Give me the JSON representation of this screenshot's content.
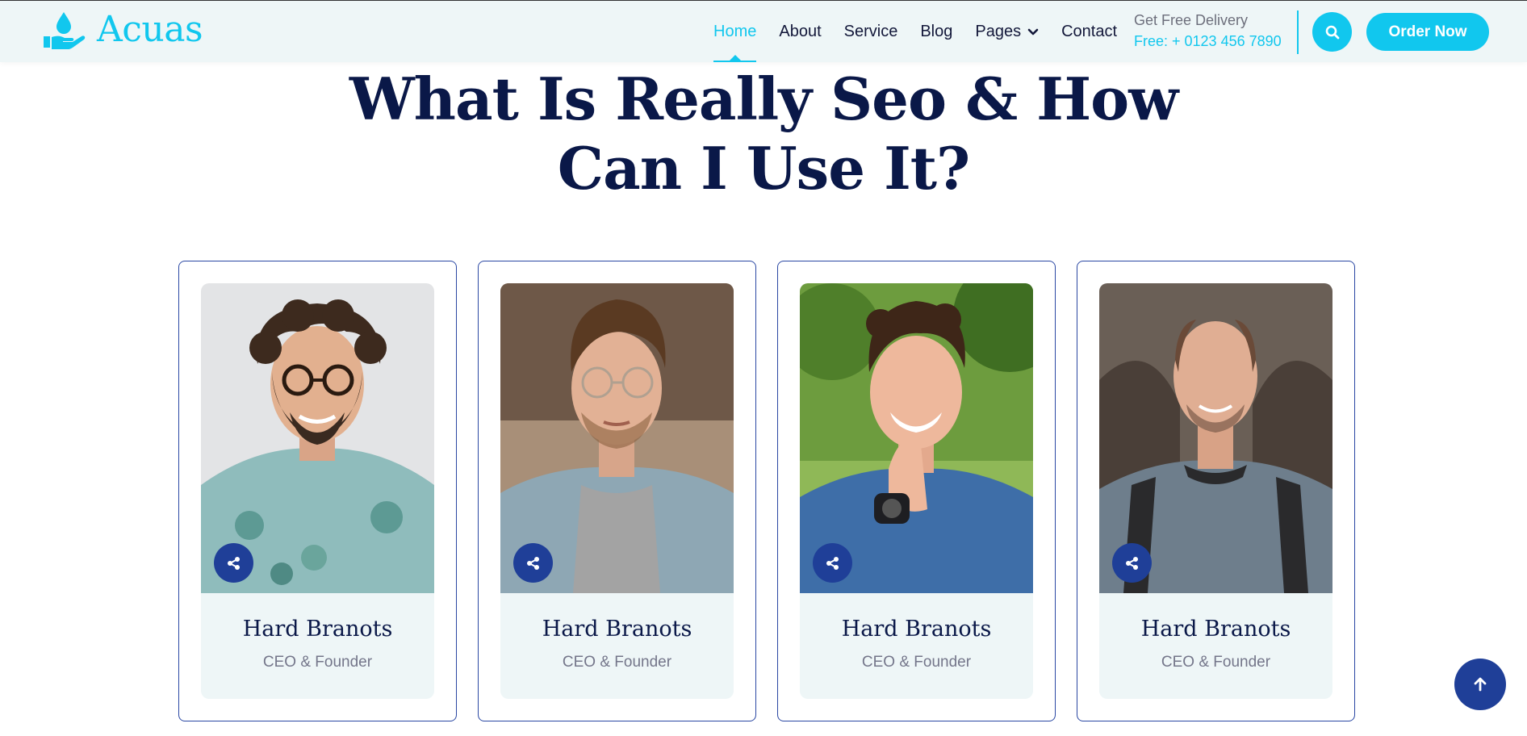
{
  "brand": {
    "name": "Acuas",
    "accent_color": "#11c7ee",
    "dark_color": "#0a1848",
    "secondary_color": "#1f3f98"
  },
  "nav": {
    "items": [
      {
        "label": "Home",
        "active": true
      },
      {
        "label": "About",
        "active": false
      },
      {
        "label": "Service",
        "active": false
      },
      {
        "label": "Blog",
        "active": false
      },
      {
        "label": "Pages",
        "active": false,
        "icon": "chevron-down-icon"
      },
      {
        "label": "Contact",
        "active": false
      }
    ]
  },
  "delivery": {
    "label": "Get Free Delivery",
    "phone": "Free: + 0123 456 7890"
  },
  "header_actions": {
    "search_icon": "search-icon",
    "order_label": "Order Now"
  },
  "section": {
    "title_line1": "What Is Really Seo & How",
    "title_line2": "Can I Use It?"
  },
  "team": [
    {
      "name": "Hard Branots",
      "role": "CEO & Founder",
      "share_icon": "share-icon"
    },
    {
      "name": "Hard Branots",
      "role": "CEO & Founder",
      "share_icon": "share-icon"
    },
    {
      "name": "Hard Branots",
      "role": "CEO & Founder",
      "share_icon": "share-icon"
    },
    {
      "name": "Hard Branots",
      "role": "CEO & Founder",
      "share_icon": "share-icon"
    }
  ],
  "back_to_top": {
    "icon": "arrow-up-icon"
  }
}
